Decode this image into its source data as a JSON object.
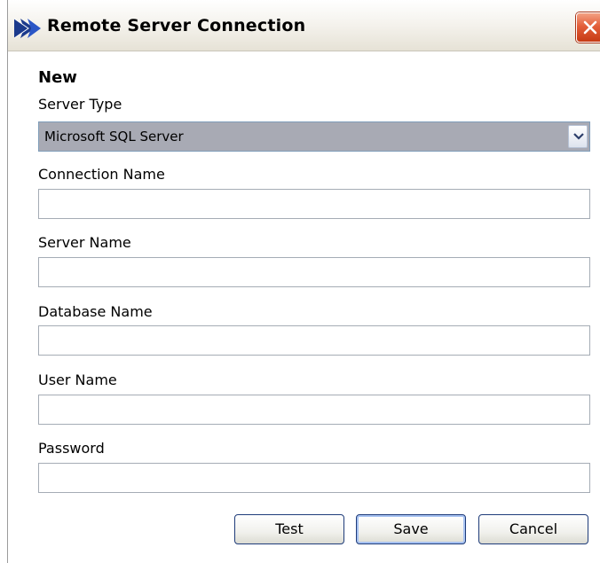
{
  "window": {
    "title": "Remote Server Connection",
    "icon": "app-logo-icon",
    "close_icon": "close-icon"
  },
  "form": {
    "heading": "New",
    "server_type_label": "Server Type",
    "server_type_value": "Microsoft SQL Server",
    "connection_name_label": "Connection Name",
    "connection_name_value": "",
    "server_name_label": "Server Name",
    "server_name_value": "",
    "database_name_label": "Database Name",
    "database_name_value": "",
    "user_name_label": "User Name",
    "user_name_value": "",
    "password_label": "Password",
    "password_value": ""
  },
  "buttons": {
    "test": "Test",
    "save": "Save",
    "cancel": "Cancel"
  },
  "colors": {
    "close_red": "#e35f3a",
    "select_background": "#a8aab4",
    "button_border": "#1f3c7a"
  }
}
